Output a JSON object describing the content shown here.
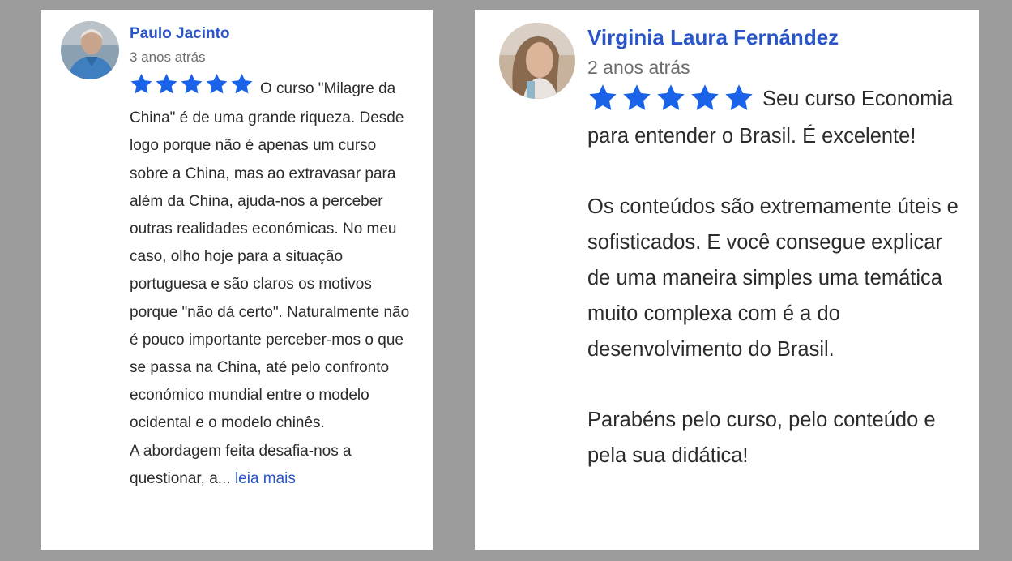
{
  "reviews": [
    {
      "name": "Paulo Jacinto",
      "time": "3 anos atrás",
      "rating": 5,
      "text_lines": [
        "O curso \"Milagre da China\" é de uma grande riqueza. Desde logo porque não é apenas um curso sobre a China, mas ao extravasar para além da China, ajuda-nos a perceber outras realidades económicas. No meu caso, olho hoje para a situação portuguesa e são claros os motivos porque \"não dá certo\". Naturalmente não é pouco importante perceber-mos o que se passa na China, até pelo confronto económico mundial entre o modelo ocidental e o modelo chinês.",
        "A abordagem feita desafia-nos a questionar, a..."
      ],
      "read_more": "leia mais"
    },
    {
      "name": "Virginia Laura Fernández",
      "time": "2 anos atrás",
      "rating": 5,
      "paragraphs": [
        "Seu curso Economia para entender o Brasil. É excelente!",
        "Os conteúdos são extremamente úteis e sofisticados. E você consegue explicar de uma maneira simples uma temática muito complexa com é a do desenvolvimento do Brasil.",
        "Parabéns pelo curso, pelo conteúdo e pela sua didática!"
      ]
    }
  ],
  "colors": {
    "star": "#1a62e8",
    "name": "#2a55c6",
    "background": "#9b9b9b",
    "card": "#ffffff"
  },
  "icons": {
    "rating": "star-icon",
    "avatar": "profile-photo"
  }
}
